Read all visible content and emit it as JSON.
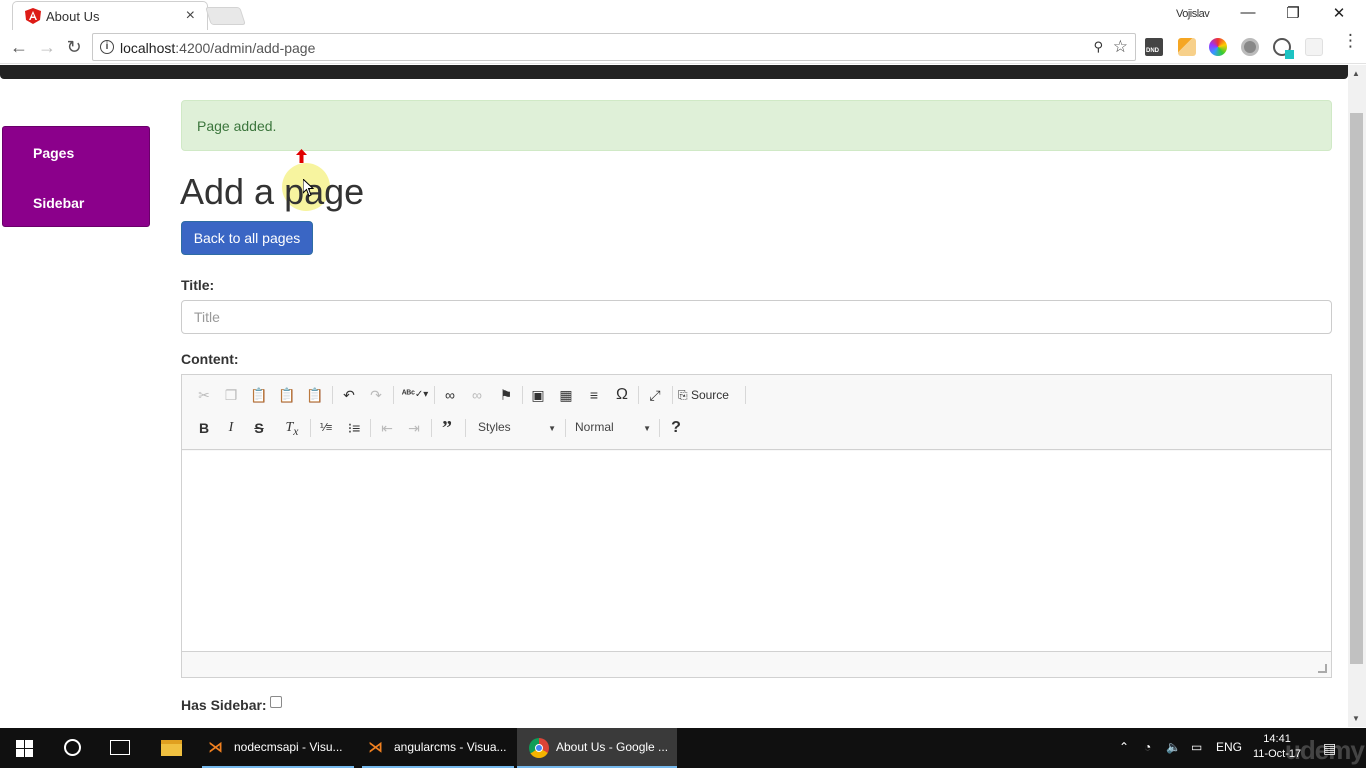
{
  "browser": {
    "tab_title": "About Us",
    "tab_close": "×",
    "profile_name": "Vojislav",
    "window": {
      "minimize": "—",
      "restore": "❐",
      "close": "✕"
    },
    "nav": {
      "back": "←",
      "forward": "→",
      "reload": "↻"
    },
    "url_host": "localhost",
    "url_path": ":4200/admin/add-page",
    "ext_dnd_label": "DND",
    "menu": "⋮"
  },
  "sidebar": {
    "items": [
      {
        "label": "Pages"
      },
      {
        "label": "Sidebar"
      }
    ],
    "bg_color": "#8b008b"
  },
  "alert": {
    "text": "Page added."
  },
  "page": {
    "heading": "Add a page",
    "back_button": "Back to all pages",
    "title_label": "Title:",
    "title_placeholder": "Title",
    "title_value": "",
    "content_label": "Content:",
    "has_sidebar_label": "Has Sidebar:",
    "has_sidebar_checked": false
  },
  "editor": {
    "row1": [
      "cut-icon",
      "copy-icon",
      "paste-icon",
      "paste-text-icon",
      "paste-word-icon",
      "undo-icon",
      "redo-icon",
      "spellcheck-icon",
      "link-icon",
      "unlink-icon",
      "anchor-icon",
      "image-icon",
      "table-icon",
      "horizontal-rule-icon",
      "special-char-icon",
      "maximize-icon",
      "source-icon"
    ],
    "source_label": "Source",
    "row2": [
      "bold-icon",
      "italic-icon",
      "strike-icon",
      "remove-format-icon",
      "numbered-list-icon",
      "bulleted-list-icon",
      "outdent-icon",
      "indent-icon",
      "blockquote-icon",
      "help-icon"
    ],
    "styles_label": "Styles",
    "format_label": "Normal",
    "help_label": "?"
  },
  "taskbar": {
    "apps": [
      {
        "label": "nodecmsapi - Visu..."
      },
      {
        "label": "angularcms - Visua..."
      },
      {
        "label": "About Us - Google ..."
      }
    ],
    "lang": "ENG",
    "time": "14:41",
    "date": "11-Oct-17",
    "watermark": "udemy"
  },
  "colors": {
    "alert_bg": "#dff0d8",
    "alert_text": "#3c763d",
    "primary": "#3a66c4",
    "nav_bar": "#222222"
  }
}
